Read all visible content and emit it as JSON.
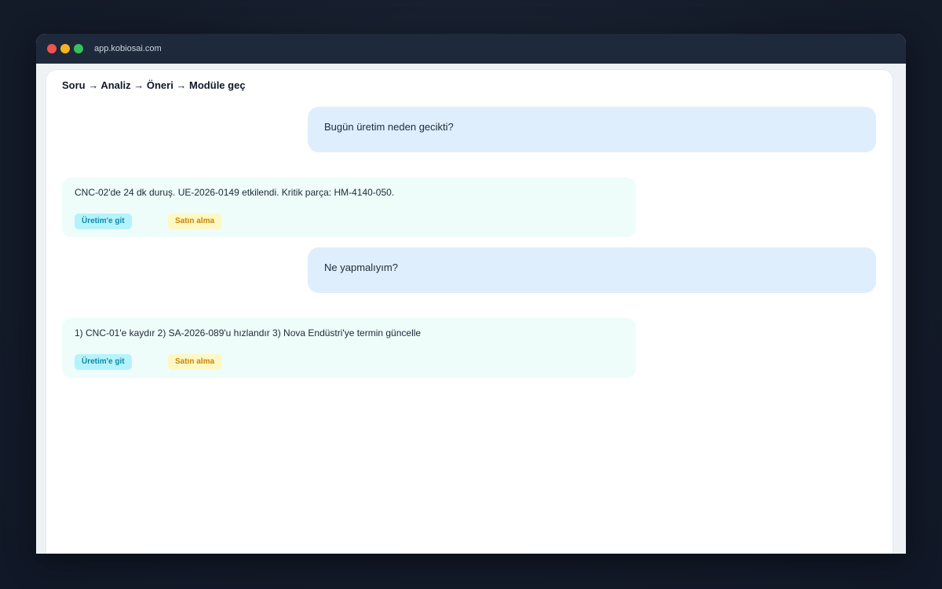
{
  "window": {
    "url": "app.kobiosai.com"
  },
  "header": {
    "breadcrumb": "Soru → Analiz → Öneri → Modüle geç"
  },
  "messages": [
    {
      "role": "user",
      "text": "Bugün üretim neden gecikti?"
    },
    {
      "role": "assistant",
      "text": "CNC-02'de 24 dk duruş. UE-2026-0149 etkilendi. Kritik parça: HM-4140-050.",
      "actions": [
        "Üretim'e git",
        "Satın alma"
      ]
    },
    {
      "role": "user",
      "text": "Ne yapmalıyım?"
    },
    {
      "role": "assistant",
      "text": "1) CNC-01'e kaydır  2) SA-2026-089'u hızlandır  3) Nova Endüstri'ye termin güncelle",
      "actions": [
        "Üretim'e git",
        "Satın alma"
      ]
    }
  ],
  "colors": {
    "user_bubble": "#dfeefc",
    "assistant_bubble": "#eefcfa",
    "chip_production": "#b5f3fc",
    "chip_purchasing": "#fdf7c3"
  }
}
